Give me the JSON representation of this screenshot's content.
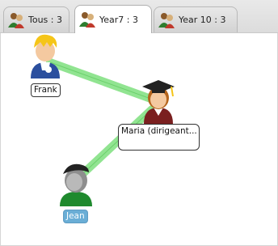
{
  "tabs": [
    {
      "label": "Tous : 3",
      "active": false
    },
    {
      "label": "Year7  : 3",
      "active": true
    },
    {
      "label": "Year 10 : 3",
      "active": false
    }
  ],
  "nodes": {
    "frank": {
      "label": "Frank",
      "avatar": "boy-blond-icon"
    },
    "maria": {
      "label": "Maria (dirigeant...",
      "avatar": "graduate-girl-icon"
    },
    "jean": {
      "label": "Jean",
      "avatar": "boy-masked-icon",
      "selected": true
    }
  },
  "colors": {
    "link": "#7ee07e",
    "selected_label": "#6aaed6"
  }
}
